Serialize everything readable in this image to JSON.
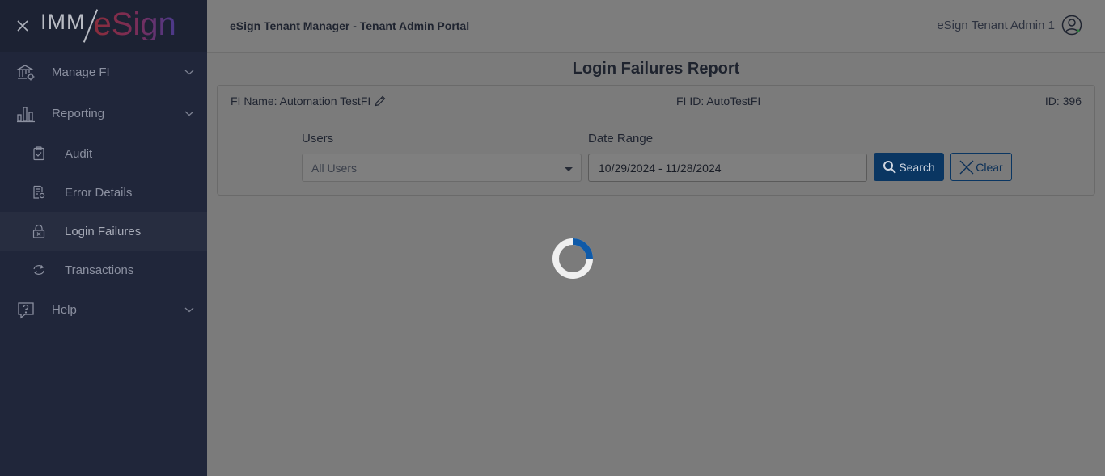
{
  "sidebar": {
    "logo": {
      "part1": "IMM",
      "part2": "eSign"
    },
    "items": [
      {
        "label": "Manage FI",
        "icon": "bank-gear-icon",
        "expandable": true
      },
      {
        "label": "Reporting",
        "icon": "bar-chart-icon",
        "expandable": true
      }
    ],
    "sub_items": [
      {
        "label": "Audit",
        "icon": "clipboard-check-icon"
      },
      {
        "label": "Error Details",
        "icon": "document-gear-icon"
      },
      {
        "label": "Login Failures",
        "icon": "lock-x-icon",
        "active": true
      },
      {
        "label": "Transactions",
        "icon": "refresh-icon"
      }
    ],
    "help": {
      "label": "Help",
      "icon": "help-bubble-icon"
    }
  },
  "header": {
    "portal_title": "eSign Tenant Manager - Tenant Admin Portal",
    "user_name": "eSign Tenant Admin 1"
  },
  "page": {
    "title": "Login Failures Report"
  },
  "card": {
    "fi_name": "FI Name: Automation TestFI",
    "fi_id": "FI ID: AutoTestFI",
    "id": "ID: 396"
  },
  "filters": {
    "users_label": "Users",
    "users_value": "All Users",
    "date_label": "Date Range",
    "date_value": "10/29/2024 - 11/28/2024",
    "search_label": "Search",
    "clear_label": "Clear"
  },
  "colors": {
    "sidebar_bg": "#20263a",
    "primary": "#0a3662",
    "spinner_accent": "#0f5aa8"
  }
}
